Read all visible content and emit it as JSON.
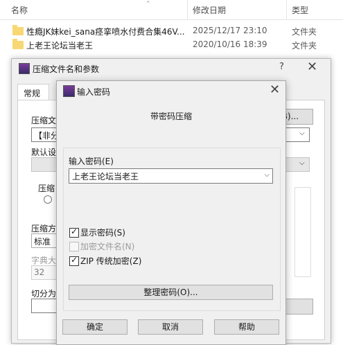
{
  "explorer": {
    "columns": {
      "name": "名称",
      "date": "修改日期",
      "type": "类型"
    },
    "rows": [
      {
        "name": "性瘾JK妹kei_sana痉挛喷水付费合集46V...",
        "date": "2025/12/17 23:10",
        "type": "文件夹"
      },
      {
        "name": "上老王论坛当老王",
        "date": "2020/10/16 18:39",
        "type": "文件夹"
      }
    ]
  },
  "archive_dialog": {
    "title": "压缩文件名和参数",
    "help": "?",
    "close": "✕",
    "tab_general": "常规",
    "archive_name_label": "压缩文",
    "archive_name_value": "【非分",
    "browse_label": "(B)...",
    "profile_label": "默认设",
    "update_label": "压缩",
    "method_label": "压缩方",
    "method_value": "标准",
    "dict_label": "字典大",
    "dict_value": "32",
    "split_label": "切分为"
  },
  "password_dialog": {
    "title": "输入密码",
    "close": "✕",
    "heading": "带密码压缩",
    "password_label": "输入密码(E)",
    "password_value": "上老王论坛当老王",
    "show_password": {
      "label": "显示密码(S)",
      "checked": true
    },
    "encrypt_names": {
      "label": "加密文件名(N)",
      "checked": false,
      "disabled": true
    },
    "zip_legacy": {
      "label": "ZIP 传统加密(Z)",
      "checked": true
    },
    "organize_button": "整理密码(O)...",
    "ok_button": "确定",
    "cancel_button": "取消",
    "help_button": "帮助"
  }
}
